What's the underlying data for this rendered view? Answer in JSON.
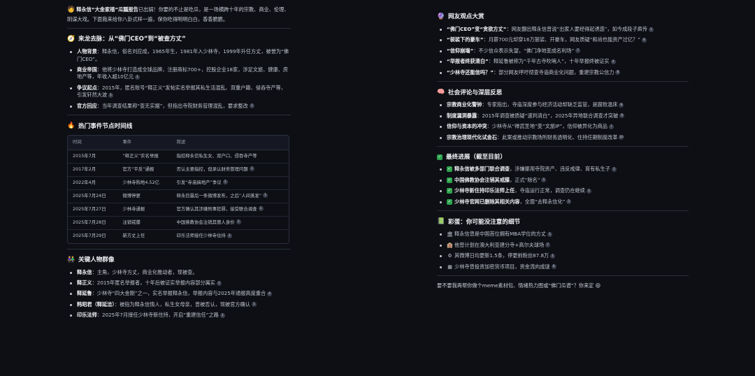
{
  "left": {
    "intro": {
      "prefix": "释永信“大金家禧”瓜瓢报告",
      "text": "已出锅！你要的不止是吃瓜，是一场横跨十年的宗教、商业、伦理、阴谋大戏。下面我来给你八卦式样一遍，保你吃得明明白白，香香脆脆。"
    },
    "origin": {
      "title": "来龙去脉：从“佛门CEO”到“被查方丈”",
      "items": [
        {
          "label": "人物背景",
          "text": "：释永信，俗名刘应成，1965年生，1981年入少林寺，1999年升任方丈，被誉为“佛门CEO”。",
          "cite": ""
        },
        {
          "label": "商业帝国",
          "text": "：他将少林寺打造成全球品牌，注册商标700+，控股企业18家，涉足文旅、健康、房地产等，年收入超10亿元",
          "cite": "1"
        },
        {
          "label": "争议起点",
          "text": "：2015年，匿名账号“释正义”发帖实名举报其私生活混乱、双重户籍、侵吞寺产等，引发轩然大波",
          "cite": "1"
        },
        {
          "label": "官方回应",
          "text": "：当年调查结果称“查无实据”，但指出寺院财务管理混乱，要求整改",
          "cite": "1"
        }
      ]
    },
    "timeline": {
      "title": "热门事件节点时间线",
      "headers": [
        "时间",
        "事件",
        "简述"
      ],
      "rows": [
        [
          "2015年7月",
          "“释正义”实名举报",
          "指控释永信私生女、双户口、侵吞寺产等"
        ],
        [
          "2017年2月",
          "官方“平反”通报",
          "否认主要指控，但承认财务管理问题"
        ],
        [
          "2022年4月",
          "少林寺购地4.52亿",
          "引发“寺庙搞地产”争议"
        ],
        [
          "2025年7月24日",
          "微博停更",
          "释永信最后一条微博发布，之后“人间蒸发”"
        ],
        [
          "2025年7月27日",
          "少林寺通报",
          "官方确认其涉嫌刑事犯罪，接受联合调查"
        ],
        [
          "2025年7月28日",
          "注销戒牒",
          "中国佛教协会注销其僧人身份"
        ],
        [
          "2025年7月29日",
          "新方丈上任",
          "印乐法师接任少林寺住持"
        ]
      ],
      "cites": [
        "",
        "1",
        "1",
        "1",
        "1",
        "1",
        "1"
      ]
    },
    "people": {
      "title": "关键人物群像",
      "items": [
        {
          "label": "释永信",
          "text": "：主角，少林寺方丈，商业化推动者，现被查。",
          "cite": ""
        },
        {
          "label": "释正义",
          "text": "：2015年匿名举报者，十年后被证实举报内容部分属实",
          "cite": "1"
        },
        {
          "label": "释延鲁",
          "text": "：少林寺“四大金刚”之一，实名举报释永信，举报内容与2025年通报高度重合",
          "cite": "4"
        },
        {
          "label": "韩昭君（释延洁）",
          "text": "：被指为释永信情人，私生女母亲，曾被否认，现被官方确认",
          "cite": "1"
        },
        {
          "label": "印乐法师",
          "text": "：2025年7月接任少林寺新住持，开启“重建信任”之路",
          "cite": "1"
        }
      ]
    }
  },
  "right": {
    "opinions": {
      "title": "网友观点大赏",
      "items": [
        {
          "label": "“佛门CEO”变“贪欲方丈”",
          "text": "：网友翻出释永信曾说“出家人要经得起诱惑”，如今成段子疯传",
          "cite": "1"
        },
        {
          "label": "“袈裟下的豪车”",
          "text": "：月薪700元却穿16万袈裟、开豪车，网友质疑“和尚也能资产过亿？”",
          "cite": "6"
        },
        {
          "label": "“信仰崩塌”",
          "text": "：不少信众表示失望，“佛门净地变成名利场”",
          "cite": "7"
        },
        {
          "label": "“举报者终获清白”",
          "text": "：释延鲁被称为“千年古寺吹哨人”，十年举报终被证实",
          "cite": "4"
        },
        {
          "label": "“少林寺还能信吗？”",
          "text": "：部分网友呼吁彻查寺庙商业化问题，重建宗教公信力",
          "cite": "8"
        }
      ]
    },
    "reflection": {
      "title": "社会评论与深层反思",
      "items": [
        {
          "label": "宗教商业化警钟",
          "text": "：专家指出，寺庙深度参与经济活动却缺乏监管，是腐败温床",
          "cite": "9"
        },
        {
          "label": "制度漏洞暴露",
          "text": "：2015年调查被质疑“速判清白”，2025年异地联合调查才突破",
          "cite": "6"
        },
        {
          "label": "信仰与资本的冲突",
          "text": "：少林寺从“禅武圣地”变“文旅IP”，信仰被异化为商品",
          "cite": "7"
        },
        {
          "label": "宗教治理现代化试金石",
          "text": "：此案或推动宗教场所财务透明化、住持任期制度改革",
          "cite": "10"
        }
      ]
    },
    "progress": {
      "title": "最终进展（截至目前）",
      "items": [
        {
          "label": "释永信被多部门联合调查",
          "text": "，涉嫌挪用寺院资产、违反戒律、育有私生子",
          "cite": "1"
        },
        {
          "label": "中国佛教协会注销其戒牒",
          "text": "，正式“除名”",
          "cite": "1"
        },
        {
          "label": "少林寺新住持印乐法师上任",
          "text": "，寺庙运行正常，调查仍在继续",
          "cite": "1"
        },
        {
          "label": "少林寺官网已删除其相关内容",
          "text": "，全面“去释永信化”",
          "cite": "1"
        }
      ]
    },
    "easter": {
      "title": "彩蛋：你可能没注意的细节",
      "items": [
        {
          "icon": "🏛",
          "text": "释永信曾是中国首位拥有MBA学位的方丈",
          "cite": "1"
        },
        {
          "icon": "🏨",
          "text": "他曾计划在澳大利亚建分寺+高尔夫球场",
          "cite": "7"
        },
        {
          "icon": "⚙",
          "text": "其微博日均更新1.5条，停更前粉丝87.8万",
          "cite": "1"
        },
        {
          "icon": "▦",
          "text": "少林寺曾投资加密货币项目，资金流向成谜",
          "cite": "6"
        }
      ]
    },
    "outro": "要不要我再帮你做个meme素材包、情绪热力图或“佛门瓜谱”？你来定 😄"
  }
}
